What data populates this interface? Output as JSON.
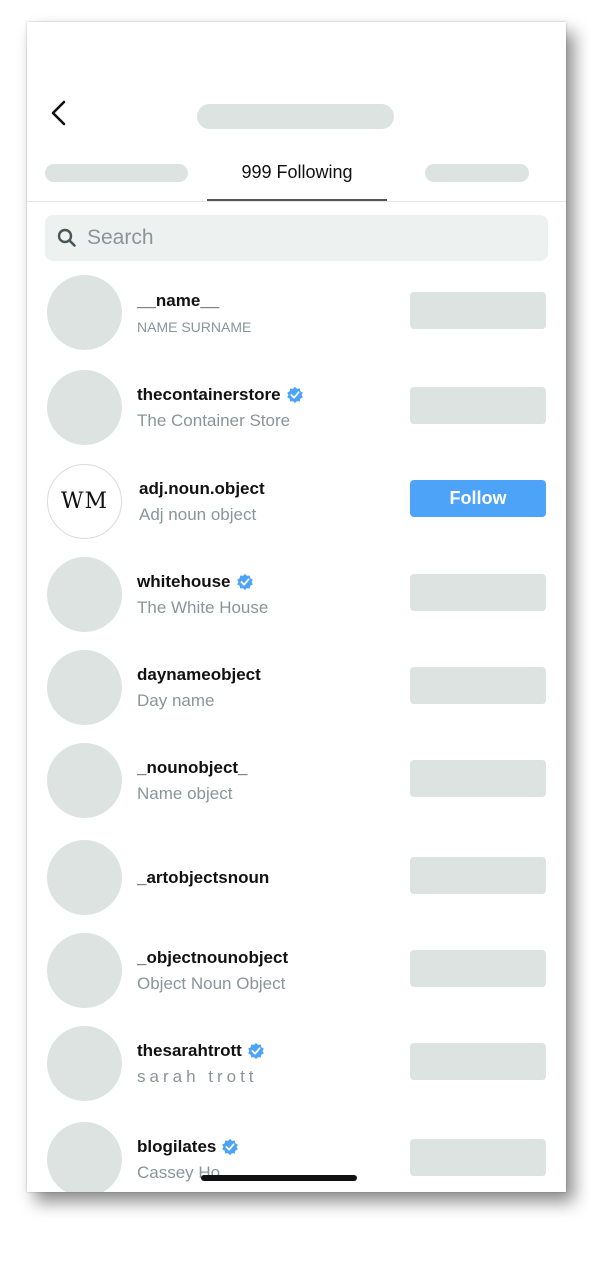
{
  "header": {
    "active_tab_label": "999 Following"
  },
  "search": {
    "placeholder": "Search"
  },
  "accounts": [
    {
      "username": "__name__",
      "full_name": "NAME SURNAME",
      "verified": false
    },
    {
      "username": "thecontainerstore",
      "full_name": "The Container Store",
      "verified": true
    },
    {
      "username": "adj.noun.object",
      "full_name": "Adj noun object",
      "verified": false,
      "avatar_text": "WM",
      "follow_label": "Follow"
    },
    {
      "username": "whitehouse",
      "full_name": "The White House",
      "verified": true
    },
    {
      "username": "daynameobject",
      "full_name": "Day name",
      "verified": false
    },
    {
      "username": "_nounobject_",
      "full_name": "Name object",
      "verified": false
    },
    {
      "username": "_artobjectsnoun",
      "full_name": "",
      "verified": false
    },
    {
      "username": "_objectnounobject",
      "full_name": "Object Noun Object",
      "verified": false
    },
    {
      "username": "thesarahtrott",
      "full_name": "sarah trott",
      "verified": true
    },
    {
      "username": "blogilates",
      "full_name": "Cassey Ho",
      "verified": true
    }
  ],
  "colors": {
    "accent": "#4da3f7",
    "placeholder": "#dde3e1",
    "verified": "#4da3f7"
  }
}
